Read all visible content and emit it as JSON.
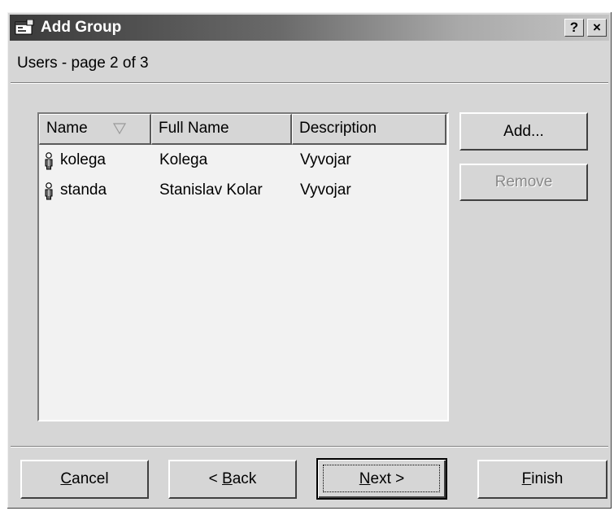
{
  "window": {
    "title": "Add Group",
    "help_label": "?",
    "close_label": "×"
  },
  "header": {
    "subtitle": "Users - page 2 of 3"
  },
  "list": {
    "columns": [
      "Name",
      "Full Name",
      "Description"
    ],
    "sort_column": "Name",
    "rows": [
      {
        "name": "kolega",
        "full_name": "Kolega",
        "description": "Vyvojar",
        "icon": "user-icon"
      },
      {
        "name": "standa",
        "full_name": "Stanislav Kolar",
        "description": "Vyvojar",
        "icon": "user-icon"
      }
    ]
  },
  "side_buttons": {
    "add": "Add...",
    "remove": "Remove",
    "remove_enabled": false
  },
  "footer": {
    "cancel": {
      "label": "Cancel",
      "accel": "C",
      "rest": "ancel"
    },
    "back": {
      "label": "< Back",
      "pre": "< ",
      "accel": "B",
      "rest": "ack"
    },
    "next": {
      "label": "Next >",
      "accel": "N",
      "rest": "ext >"
    },
    "finish": {
      "label": "Finish",
      "accel": "F",
      "rest": "inish"
    }
  },
  "colors": {
    "face": "#d6d6d6",
    "title_dark": "#3a3a3a",
    "disabled_text": "#888888"
  }
}
